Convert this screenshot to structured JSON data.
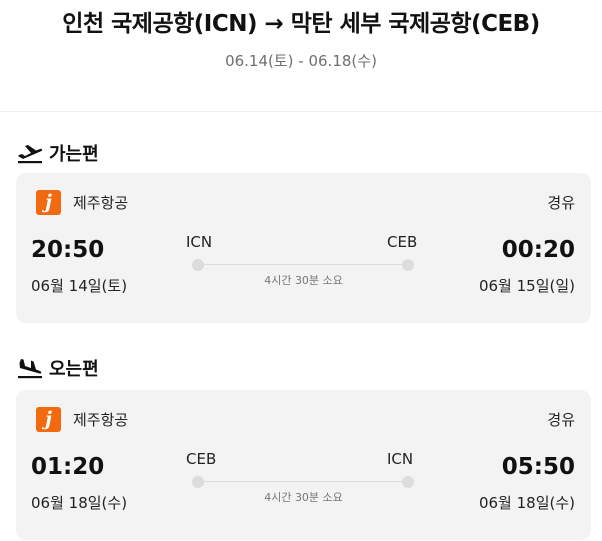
{
  "header": {
    "title": "인천 국제공항(ICN) → 막탄 세부 국제공항(CEB)",
    "dates": "06.14(토) - 06.18(수)"
  },
  "outbound": {
    "section_title": "가는편",
    "icon": "plane-departure-icon",
    "airline": "제주항공",
    "logo_letter": "j",
    "stops": "경유",
    "departure_time": "20:50",
    "departure_date": "06월 14일(토)",
    "departure_code": "ICN",
    "arrival_code": "CEB",
    "arrival_time": "00:20",
    "arrival_date": "06월 15일(일)",
    "duration": "4시간 30분 소요"
  },
  "inbound": {
    "section_title": "오는편",
    "icon": "plane-arrival-icon",
    "airline": "제주항공",
    "logo_letter": "j",
    "stops": "경유",
    "departure_time": "01:20",
    "departure_date": "06월 18일(수)",
    "departure_code": "CEB",
    "arrival_code": "ICN",
    "arrival_time": "05:50",
    "arrival_date": "06월 18일(수)",
    "duration": "4시간 30분 소요"
  },
  "colors": {
    "brand_orange": "#f26a10",
    "card_bg": "#f3f3f4"
  }
}
